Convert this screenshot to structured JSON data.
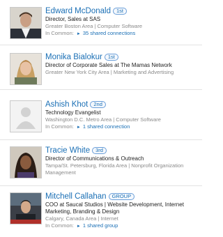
{
  "colors": {
    "link": "#1a6fb5",
    "muted": "#8a8a8a",
    "divider": "#e3e3e3"
  },
  "people": [
    {
      "name": "Edward McDonald",
      "degree": "1st",
      "headline": "Director, Sales at SAS",
      "location": "Greater Boston Area | Computer Software",
      "in_common_label": "In Common:",
      "in_common_link": "35 shared connections",
      "icon": "arrow-right-icon"
    },
    {
      "name": "Monika Bialokur",
      "degree": "1st",
      "headline": "Director of Corporate Sales at The Mamas Network",
      "location": "Greater New York City Area | Marketing and Advertising"
    },
    {
      "name": "Ashish Khot",
      "degree": "2nd",
      "headline": "Technology Evangelist",
      "location": "Washington D.C. Metro Area | Computer Software",
      "in_common_label": "In Common:",
      "in_common_link": "1 shared connection"
    },
    {
      "name": "Tracie White",
      "degree": "3rd",
      "headline": "Director of Communications & Outreach",
      "location": "Tampa/St. Petersburg, Florida Area | Nonprofit Organization Management"
    },
    {
      "name": "Mitchell Callahan",
      "degree": "GROUP",
      "headline": "COO at Saucal Studios | Website Development, Internet Marketing, Branding & Design",
      "location": "Calgary, Canada Area | Internet",
      "in_common_label": "In Common:",
      "in_common_link": "1 shared group"
    }
  ]
}
